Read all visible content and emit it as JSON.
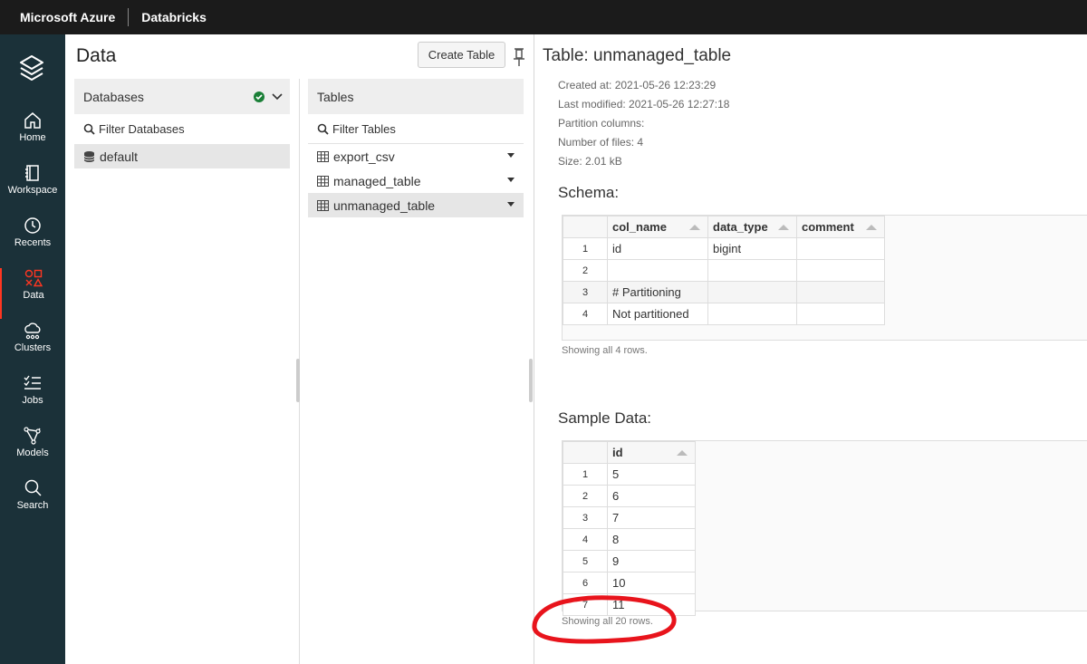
{
  "topbar": {
    "brand": "Microsoft Azure",
    "product": "Databricks"
  },
  "nav": {
    "items": [
      {
        "label": "Home",
        "icon": "home-icon"
      },
      {
        "label": "Workspace",
        "icon": "workspace-icon"
      },
      {
        "label": "Recents",
        "icon": "clock-icon"
      },
      {
        "label": "Data",
        "icon": "data-icon"
      },
      {
        "label": "Clusters",
        "icon": "cloud-icon"
      },
      {
        "label": "Jobs",
        "icon": "jobs-icon"
      },
      {
        "label": "Models",
        "icon": "models-icon"
      },
      {
        "label": "Search",
        "icon": "search-icon"
      }
    ],
    "active": "Data",
    "accent_color": "#ff3621"
  },
  "data_panel": {
    "title": "Data",
    "create_table_label": "Create Table",
    "databases": {
      "header": "Databases",
      "filter_placeholder": "Filter Databases",
      "items": [
        "default"
      ]
    },
    "tables": {
      "header": "Tables",
      "filter_placeholder": "Filter Tables",
      "items": [
        "export_csv",
        "managed_table",
        "unmanaged_table"
      ],
      "selected": "unmanaged_table"
    }
  },
  "detail": {
    "title": "Table: unmanaged_table",
    "meta": [
      "Created at: 2021-05-26 12:23:29",
      "Last modified: 2021-05-26 12:27:18",
      "Partition columns:",
      "Number of files: 4",
      "Size: 2.01 kB"
    ],
    "schema": {
      "title": "Schema:",
      "columns": [
        "col_name",
        "data_type",
        "comment"
      ],
      "rows": [
        [
          "1",
          "id",
          "bigint",
          ""
        ],
        [
          "2",
          "",
          "",
          ""
        ],
        [
          "3",
          "# Partitioning",
          "",
          ""
        ],
        [
          "4",
          "Not partitioned",
          "",
          ""
        ]
      ],
      "footer": "Showing all 4 rows."
    },
    "sample": {
      "title": "Sample Data:",
      "columns": [
        "id"
      ],
      "rows": [
        [
          "1",
          "5"
        ],
        [
          "2",
          "6"
        ],
        [
          "3",
          "7"
        ],
        [
          "4",
          "8"
        ],
        [
          "5",
          "9"
        ],
        [
          "6",
          "10"
        ],
        [
          "7",
          "11"
        ]
      ],
      "footer": "Showing all 20 rows."
    }
  },
  "annotation_color": "#e8141c"
}
